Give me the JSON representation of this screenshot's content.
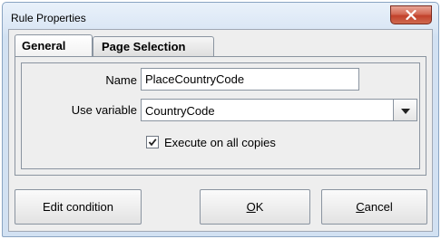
{
  "window": {
    "title": "Rule Properties",
    "close_icon": "close-icon"
  },
  "tabs": [
    {
      "label": "General",
      "selected": true
    },
    {
      "label": "Page Selection",
      "selected": false
    }
  ],
  "form": {
    "name_label": "Name",
    "name_value": "PlaceCountryCode",
    "variable_label": "Use variable",
    "variable_value": "CountryCode",
    "dropdown_icon": "chevron-down-icon",
    "execute_label": "Execute on all copies",
    "execute_checked": true
  },
  "buttons": {
    "edit_condition": "Edit condition",
    "ok_mnemonic": "O",
    "ok_rest": "K",
    "cancel_mnemonic": "C",
    "cancel_rest": "ancel"
  }
}
